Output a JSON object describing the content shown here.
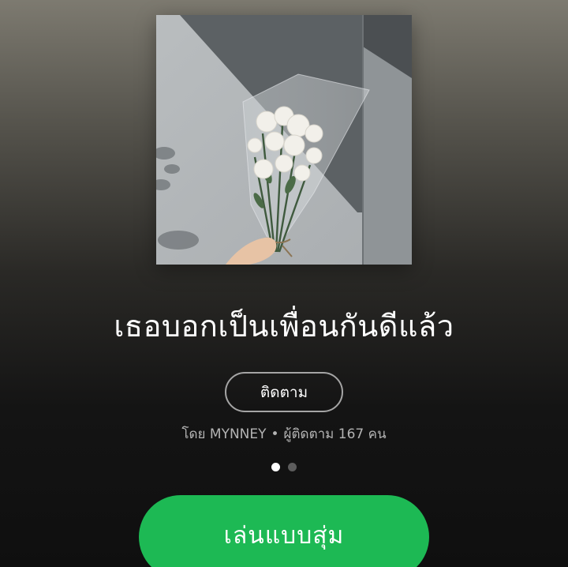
{
  "playlist": {
    "title": "เธอบอกเป็นเพื่อนกันดีแล้ว",
    "follow_label": "ติดตาม",
    "owner_line": "โดย MYNNEY",
    "separator": "•",
    "followers_line": "ผู้ติดตาม 167 คน",
    "shuffle_label": "เล่นแบบสุ่ม",
    "page_indicator": {
      "count": 2,
      "active_index": 0
    }
  },
  "colors": {
    "accent": "#1db954",
    "text_primary": "#ffffff",
    "text_secondary": "#b3b3b3",
    "outline": "#a5a5a5"
  }
}
